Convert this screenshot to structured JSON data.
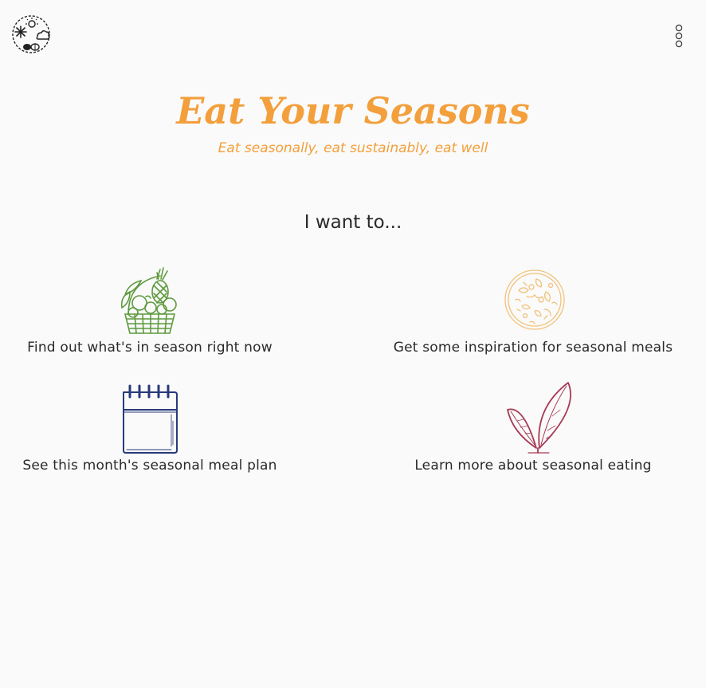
{
  "header": {
    "logo_icon": "seasons-logo-icon",
    "menu_icon": "vertical-dots-menu-icon"
  },
  "hero": {
    "title": "Eat Your Seasons",
    "subtitle": "Eat seasonally, eat sustainably, eat well",
    "accent_color": "#f39f3b"
  },
  "prompt": "I want to...",
  "options": [
    {
      "label": "Find out what's in season right now",
      "icon": "produce-basket-icon",
      "color": "#5e9a3e"
    },
    {
      "label": "Get some inspiration for seasonal meals",
      "icon": "meal-plate-icon",
      "color": "#f2c27a"
    },
    {
      "label": "See this month's seasonal meal plan",
      "icon": "calendar-notepad-icon",
      "color": "#283a7a"
    },
    {
      "label": "Learn more about seasonal eating",
      "icon": "sprout-leaves-icon",
      "color": "#a83a55"
    }
  ]
}
